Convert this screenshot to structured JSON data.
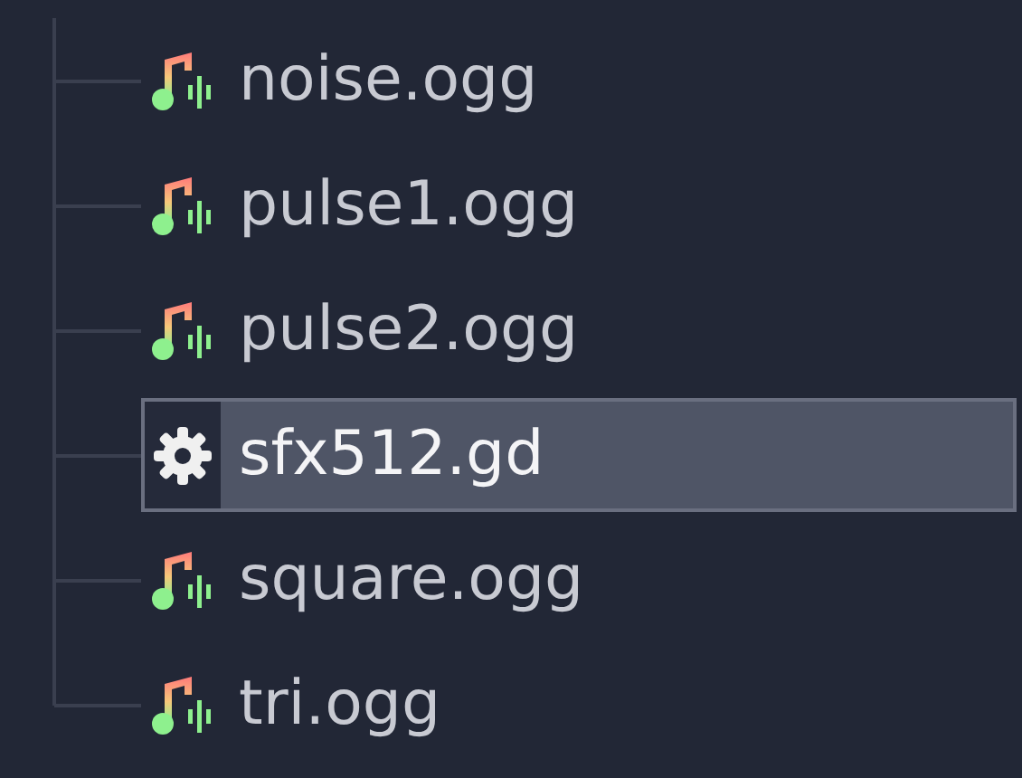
{
  "files": [
    {
      "name": "noise.ogg",
      "kind": "audio",
      "selected": false
    },
    {
      "name": "pulse1.ogg",
      "kind": "audio",
      "selected": false
    },
    {
      "name": "pulse2.ogg",
      "kind": "audio",
      "selected": false
    },
    {
      "name": "sfx512.gd",
      "kind": "script",
      "selected": true
    },
    {
      "name": "square.ogg",
      "kind": "audio",
      "selected": false
    },
    {
      "name": "tri.ogg",
      "kind": "audio",
      "selected": false
    }
  ]
}
